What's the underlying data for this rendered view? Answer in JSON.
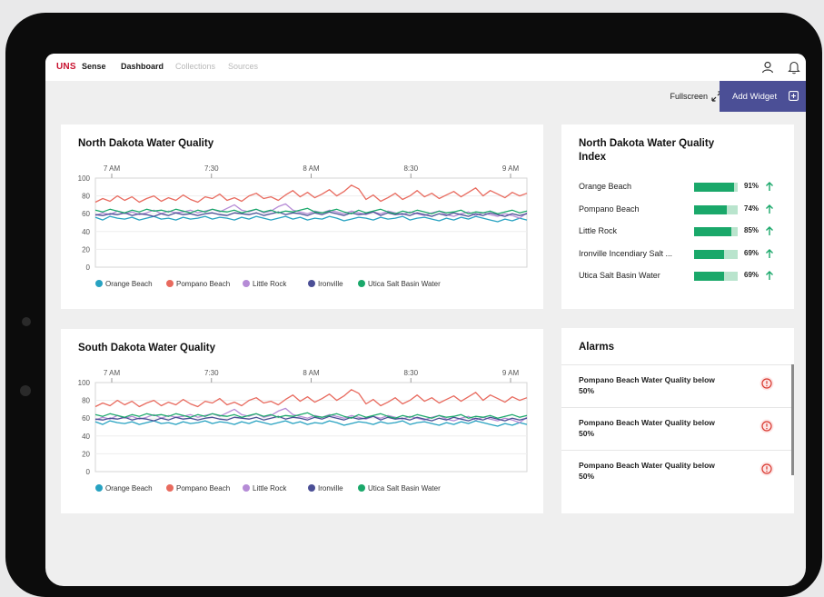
{
  "header": {
    "logo": "UNS",
    "brand": "Sense",
    "nav": [
      "Dashboard",
      "Collections",
      "Sources"
    ]
  },
  "toolbar": {
    "fullscreen_label": "Fullscreen",
    "add_widget_label": "Add Widget"
  },
  "colors": {
    "accent": "#4b4f96",
    "brand": "#c8102e",
    "good": "#1aa86a"
  },
  "icons": [
    "user-icon",
    "bell-icon",
    "expand-icon",
    "add-square-icon",
    "arrow-up-icon",
    "alert-circle-icon"
  ],
  "cards": {
    "north_title": "North Dakota Water Quality",
    "south_title": "South Dakota Water Quality",
    "index_title": "North Dakota Water Quality Index",
    "alarms_title": "Alarms"
  },
  "quality_index": [
    {
      "name": "Orange Beach",
      "pct": "91%",
      "value": 0.91
    },
    {
      "name": "Pompano Beach",
      "pct": "74%",
      "value": 0.74
    },
    {
      "name": "Little Rock",
      "pct": "85%",
      "value": 0.85
    },
    {
      "name": "Ironville Incendiary Salt ...",
      "pct": "69%",
      "value": 0.69
    },
    {
      "name": "Utica Salt Basin Water",
      "pct": "69%",
      "value": 0.69
    }
  ],
  "alarms": [
    {
      "text": "Pompano Beach Water Quality below 50%"
    },
    {
      "text": "Pompano Beach Water Quality below 50%"
    },
    {
      "text": "Pompano Beach Water Quality below 50%"
    }
  ],
  "chart_data": [
    {
      "type": "line",
      "title": "North Dakota Water Quality",
      "x_ticks": [
        "7 AM",
        "7:30",
        "8 AM",
        "8:30",
        "9 AM"
      ],
      "y_ticks": [
        "100",
        "80",
        "60",
        "40",
        "20",
        "0"
      ],
      "ylim": [
        0,
        100
      ],
      "grid": true,
      "legend_position": "bottom",
      "series": [
        {
          "name": "Orange Beach",
          "color": "#27a2c1",
          "values": [
            56,
            53,
            57,
            55,
            54,
            56,
            53,
            55,
            57,
            54,
            55,
            53,
            56,
            54,
            55,
            57,
            54,
            56,
            55,
            53,
            56,
            54,
            57,
            55,
            53,
            55,
            57,
            54,
            56,
            53,
            55,
            54,
            57,
            55,
            52,
            54,
            56,
            55,
            53,
            56,
            54,
            55,
            57,
            53,
            55,
            56,
            54,
            52,
            55,
            53,
            56,
            54,
            57,
            55,
            53,
            51,
            54,
            52,
            55,
            53
          ]
        },
        {
          "name": "Pompano Beach",
          "color": "#e86a5e",
          "values": [
            73,
            77,
            74,
            80,
            75,
            79,
            73,
            77,
            80,
            74,
            78,
            75,
            81,
            76,
            73,
            79,
            77,
            82,
            75,
            78,
            74,
            80,
            83,
            77,
            79,
            75,
            81,
            86,
            79,
            84,
            78,
            82,
            87,
            80,
            85,
            92,
            88,
            76,
            81,
            74,
            78,
            83,
            76,
            80,
            86,
            79,
            83,
            77,
            81,
            85,
            79,
            84,
            89,
            80,
            86,
            82,
            78,
            84,
            80,
            83
          ]
        },
        {
          "name": "Little Rock",
          "color": "#b58bd6",
          "values": [
            58,
            61,
            59,
            63,
            60,
            62,
            59,
            61,
            64,
            60,
            63,
            61,
            62,
            64,
            61,
            63,
            65,
            62,
            66,
            70,
            64,
            62,
            65,
            61,
            63,
            68,
            71,
            64,
            62,
            60,
            63,
            61,
            64,
            62,
            60,
            63,
            61,
            59,
            62,
            60,
            63,
            61,
            59,
            62,
            60,
            58,
            61,
            63,
            59,
            57,
            60,
            62,
            58,
            61,
            59,
            57,
            60,
            58,
            55,
            61
          ]
        },
        {
          "name": "Ironville",
          "color": "#4b4f96",
          "values": [
            59,
            58,
            60,
            59,
            61,
            58,
            60,
            59,
            57,
            60,
            58,
            61,
            59,
            60,
            58,
            60,
            61,
            59,
            58,
            61,
            60,
            59,
            61,
            58,
            60,
            62,
            59,
            61,
            60,
            58,
            61,
            59,
            62,
            60,
            58,
            61,
            59,
            60,
            62,
            58,
            61,
            59,
            60,
            58,
            61,
            59,
            57,
            60,
            58,
            61,
            59,
            57,
            60,
            58,
            61,
            59,
            57,
            60,
            58,
            60
          ]
        },
        {
          "name": "Utica Salt Basin Water",
          "color": "#1aa86a",
          "values": [
            64,
            62,
            65,
            63,
            61,
            64,
            62,
            65,
            63,
            64,
            62,
            65,
            63,
            61,
            64,
            62,
            65,
            63,
            62,
            64,
            61,
            63,
            65,
            62,
            64,
            61,
            63,
            62,
            64,
            66,
            62,
            61,
            63,
            65,
            62,
            60,
            64,
            61,
            63,
            65,
            62,
            60,
            63,
            61,
            64,
            62,
            60,
            63,
            61,
            62,
            64,
            60,
            62,
            61,
            63,
            60,
            62,
            64,
            61,
            63
          ]
        }
      ]
    },
    {
      "type": "line",
      "title": "South Dakota Water Quality",
      "x_ticks": [
        "7 AM",
        "7:30",
        "8 AM",
        "8:30",
        "9 AM"
      ],
      "y_ticks": [
        "100",
        "80",
        "60",
        "40",
        "20",
        "0"
      ],
      "ylim": [
        0,
        100
      ],
      "grid": true,
      "legend_position": "bottom",
      "series": [
        {
          "name": "Orange Beach",
          "color": "#27a2c1",
          "values": [
            56,
            53,
            57,
            55,
            54,
            56,
            53,
            55,
            57,
            54,
            55,
            53,
            56,
            54,
            55,
            57,
            54,
            56,
            55,
            53,
            56,
            54,
            57,
            55,
            53,
            55,
            57,
            54,
            56,
            53,
            55,
            54,
            57,
            55,
            52,
            54,
            56,
            55,
            53,
            56,
            54,
            55,
            57,
            53,
            55,
            56,
            54,
            52,
            55,
            53,
            56,
            54,
            57,
            55,
            53,
            51,
            54,
            52,
            55,
            53
          ]
        },
        {
          "name": "Pompano Beach",
          "color": "#e86a5e",
          "values": [
            73,
            77,
            74,
            80,
            75,
            79,
            73,
            77,
            80,
            74,
            78,
            75,
            81,
            76,
            73,
            79,
            77,
            82,
            75,
            78,
            74,
            80,
            83,
            77,
            79,
            75,
            81,
            86,
            79,
            84,
            78,
            82,
            87,
            80,
            85,
            92,
            88,
            76,
            81,
            74,
            78,
            83,
            76,
            80,
            86,
            79,
            83,
            77,
            81,
            85,
            79,
            84,
            89,
            80,
            86,
            82,
            78,
            84,
            80,
            83
          ]
        },
        {
          "name": "Little Rock",
          "color": "#b58bd6",
          "values": [
            58,
            61,
            59,
            63,
            60,
            62,
            59,
            61,
            64,
            60,
            63,
            61,
            62,
            64,
            61,
            63,
            65,
            62,
            66,
            70,
            64,
            62,
            65,
            61,
            63,
            68,
            71,
            64,
            62,
            60,
            63,
            61,
            64,
            62,
            60,
            63,
            61,
            59,
            62,
            60,
            63,
            61,
            59,
            62,
            60,
            58,
            61,
            63,
            59,
            57,
            60,
            62,
            58,
            61,
            59,
            57,
            60,
            58,
            55,
            61
          ]
        },
        {
          "name": "Ironville",
          "color": "#4b4f96",
          "values": [
            59,
            58,
            60,
            59,
            61,
            58,
            60,
            59,
            57,
            60,
            58,
            61,
            59,
            60,
            58,
            60,
            61,
            59,
            58,
            61,
            60,
            59,
            61,
            58,
            60,
            62,
            59,
            61,
            60,
            58,
            61,
            59,
            62,
            60,
            58,
            61,
            59,
            60,
            62,
            58,
            61,
            59,
            60,
            58,
            61,
            59,
            57,
            60,
            58,
            61,
            59,
            57,
            60,
            58,
            61,
            59,
            57,
            60,
            58,
            60
          ]
        },
        {
          "name": "Utica Salt Basin Water",
          "color": "#1aa86a",
          "values": [
            64,
            62,
            65,
            63,
            61,
            64,
            62,
            65,
            63,
            64,
            62,
            65,
            63,
            61,
            64,
            62,
            65,
            63,
            62,
            64,
            61,
            63,
            65,
            62,
            64,
            61,
            63,
            62,
            64,
            66,
            62,
            61,
            63,
            65,
            62,
            60,
            64,
            61,
            63,
            65,
            62,
            60,
            63,
            61,
            64,
            62,
            60,
            63,
            61,
            62,
            64,
            60,
            62,
            61,
            63,
            60,
            62,
            64,
            61,
            63
          ]
        }
      ]
    }
  ]
}
